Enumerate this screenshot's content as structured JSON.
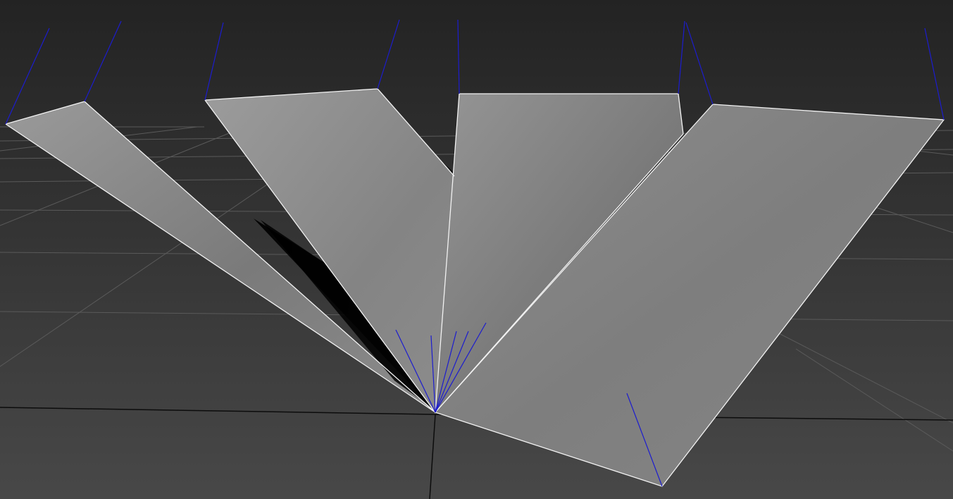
{
  "viewport": {
    "view": "perspective",
    "background_top_color": "#232323",
    "background_bottom_color": "#484848",
    "grid_color": "#5a5a5a",
    "world_axis_color": "#0c0c0c",
    "shading_mode": "smooth",
    "show_edges": true,
    "show_normals": true,
    "show_grid": true
  },
  "mesh": {
    "name": "",
    "face_count": 4,
    "shared_vertex": "fan-center",
    "face_color": "#8a8a8a",
    "edge_color": "#f2f2f2",
    "normal_color": "#1c1ccf"
  },
  "faces": [
    {
      "id": "face-1",
      "shade": "#8d8d8d",
      "shadow_side": "#161616"
    },
    {
      "id": "face-2",
      "shade": "#909090",
      "shadow_side": "#0e0e0e"
    },
    {
      "id": "face-3",
      "shade": "#8c8c8c",
      "shadow_side": "#121212"
    },
    {
      "id": "face-4",
      "shade": "#878787",
      "shadow_side": "#303030"
    }
  ]
}
